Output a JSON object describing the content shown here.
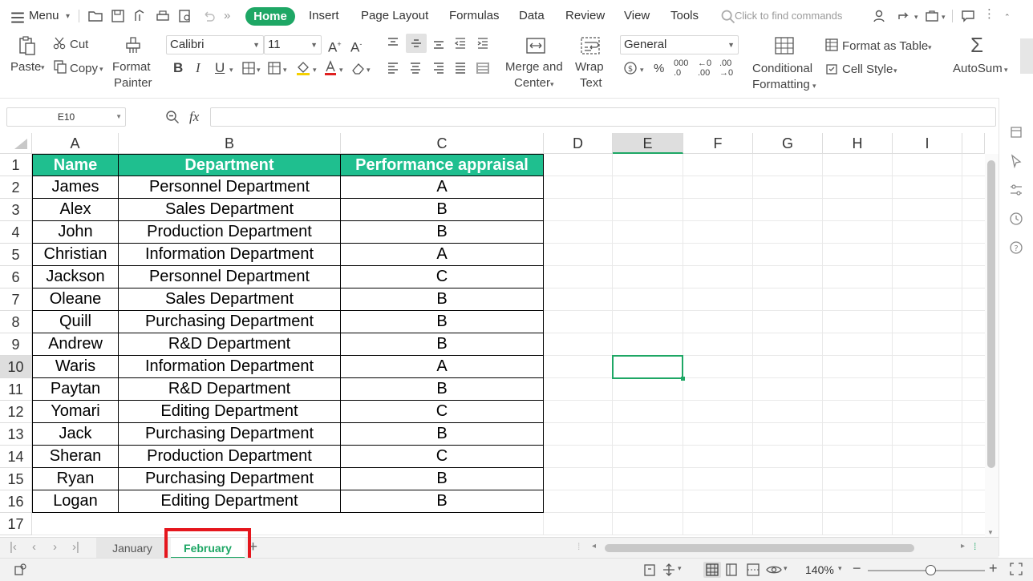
{
  "menubar": {
    "menu_label": "Menu",
    "tabs": [
      "Home",
      "Insert",
      "Page Layout",
      "Formulas",
      "Data",
      "Review",
      "View",
      "Tools"
    ],
    "active_tab": "Home",
    "search_placeholder": "Click to find commands"
  },
  "ribbon": {
    "paste": "Paste",
    "cut": "Cut",
    "copy": "Copy",
    "format_painter_1": "Format",
    "format_painter_2": "Painter",
    "font_name": "Calibri",
    "font_size": "11",
    "merge_1": "Merge and",
    "merge_2": "Center",
    "wrap_1": "Wrap",
    "wrap_2": "Text",
    "number_format": "General",
    "conditional_1": "Conditional",
    "conditional_2": "Formatting",
    "format_as_table": "Format as Table",
    "cell_style": "Cell Style",
    "autosum": "AutoSum"
  },
  "formula_bar": {
    "name_box": "E10",
    "fx_label": "fx",
    "formula_value": ""
  },
  "grid": {
    "columns": [
      "A",
      "B",
      "C",
      "D",
      "E",
      "F",
      "G",
      "H",
      "I"
    ],
    "selected_column": "E",
    "selected_row": "10",
    "row_numbers": [
      "1",
      "2",
      "3",
      "4",
      "5",
      "6",
      "7",
      "8",
      "9",
      "10",
      "11",
      "12",
      "13",
      "14",
      "15",
      "16",
      "17"
    ],
    "headers": [
      "Name",
      "Department",
      "Performance appraisal"
    ],
    "rows": [
      [
        "James",
        "Personnel Department",
        "A"
      ],
      [
        "Alex",
        "Sales Department",
        "B"
      ],
      [
        "John",
        "Production Department",
        "B"
      ],
      [
        "Christian",
        "Information Department",
        "A"
      ],
      [
        "Jackson",
        "Personnel Department",
        "C"
      ],
      [
        "Oleane",
        "Sales Department",
        "B"
      ],
      [
        "Quill",
        "Purchasing Department",
        "B"
      ],
      [
        "Andrew",
        "R&D Department",
        "B"
      ],
      [
        "Waris",
        "Information Department",
        "A"
      ],
      [
        "Paytan",
        "R&D Department",
        "B"
      ],
      [
        "Yomari",
        "Editing Department",
        "C"
      ],
      [
        "Jack",
        "Purchasing Department",
        "B"
      ],
      [
        "Sheran",
        "Production Department",
        "C"
      ],
      [
        "Ryan",
        "Purchasing Department",
        "B"
      ],
      [
        "Logan",
        "Editing Department",
        "B"
      ]
    ]
  },
  "sheets": {
    "tabs": [
      "January",
      "February"
    ],
    "active": "February"
  },
  "status": {
    "zoom": "140%"
  },
  "colors": {
    "accent": "#1ea765",
    "header_fill": "#1fbf8f",
    "highlight": "#e5161d"
  }
}
